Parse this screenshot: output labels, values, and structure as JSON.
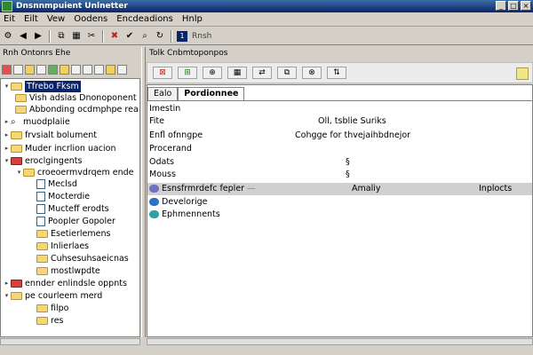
{
  "window": {
    "title": "Dnsnnmpuient Unlnetter"
  },
  "menu": [
    "Eit",
    "Eilt",
    "Vew",
    "Oodens",
    "Encdeadions",
    "Hnlp"
  ],
  "toolbar": {
    "label": "Rnsh"
  },
  "left_header": "Rnh Ontonrs Ehe",
  "right_header": "Tolk Cnbmtoponpos",
  "tree": {
    "items": [
      {
        "label": "Tfrebo Fksm",
        "selected": true
      },
      {
        "label": "Vish adslas Dnonoponent"
      },
      {
        "label": "Abbonding ocdmphpe rea"
      },
      {
        "label": "muodplaiie"
      },
      {
        "label": "frvsialt bolument"
      },
      {
        "label": "Muder incrlion uacion"
      },
      {
        "label": "eroclgingents"
      },
      {
        "label": "croeoermvdrqem ende"
      },
      {
        "label": "Meclsd"
      },
      {
        "label": "Mocterdie"
      },
      {
        "label": "Mucteff erodts"
      },
      {
        "label": "Poopler Gopoler"
      },
      {
        "label": "Esetierlemens"
      },
      {
        "label": "Inlierlaes"
      },
      {
        "label": "Cuhsesuhsaeicnas"
      },
      {
        "label": "mostlwpdte"
      },
      {
        "label": "ennder enlindsle oppnts"
      },
      {
        "label": "pe courleem merd"
      },
      {
        "label": "filpo"
      },
      {
        "label": "res"
      }
    ]
  },
  "tabs": [
    "Ealo",
    "Pordionnee"
  ],
  "properties": [
    {
      "key": "Imestin",
      "value": ""
    },
    {
      "key": "Fite",
      "value": "Oll, tsblie Suriks"
    },
    {
      "key": "Enfl ofnngpe",
      "value": "Cohgge for thvejaihbdnejor"
    },
    {
      "key": "Procerand",
      "value": ""
    },
    {
      "key": "Odats",
      "value": "§"
    },
    {
      "key": "Mouss",
      "value": "§"
    },
    {
      "key": "Esnsfrmrdefc fepler",
      "value": "Amaliy",
      "extra": "Inplocts"
    },
    {
      "key": "Develorige",
      "value": ""
    },
    {
      "key": "Ephmennents",
      "value": ""
    }
  ],
  "colors": {
    "title_bg": "#0a246a",
    "window_bg": "#d4d0c8",
    "folder": "#f5d77a",
    "folder_red": "#d84040",
    "selection": "#0a246a"
  }
}
